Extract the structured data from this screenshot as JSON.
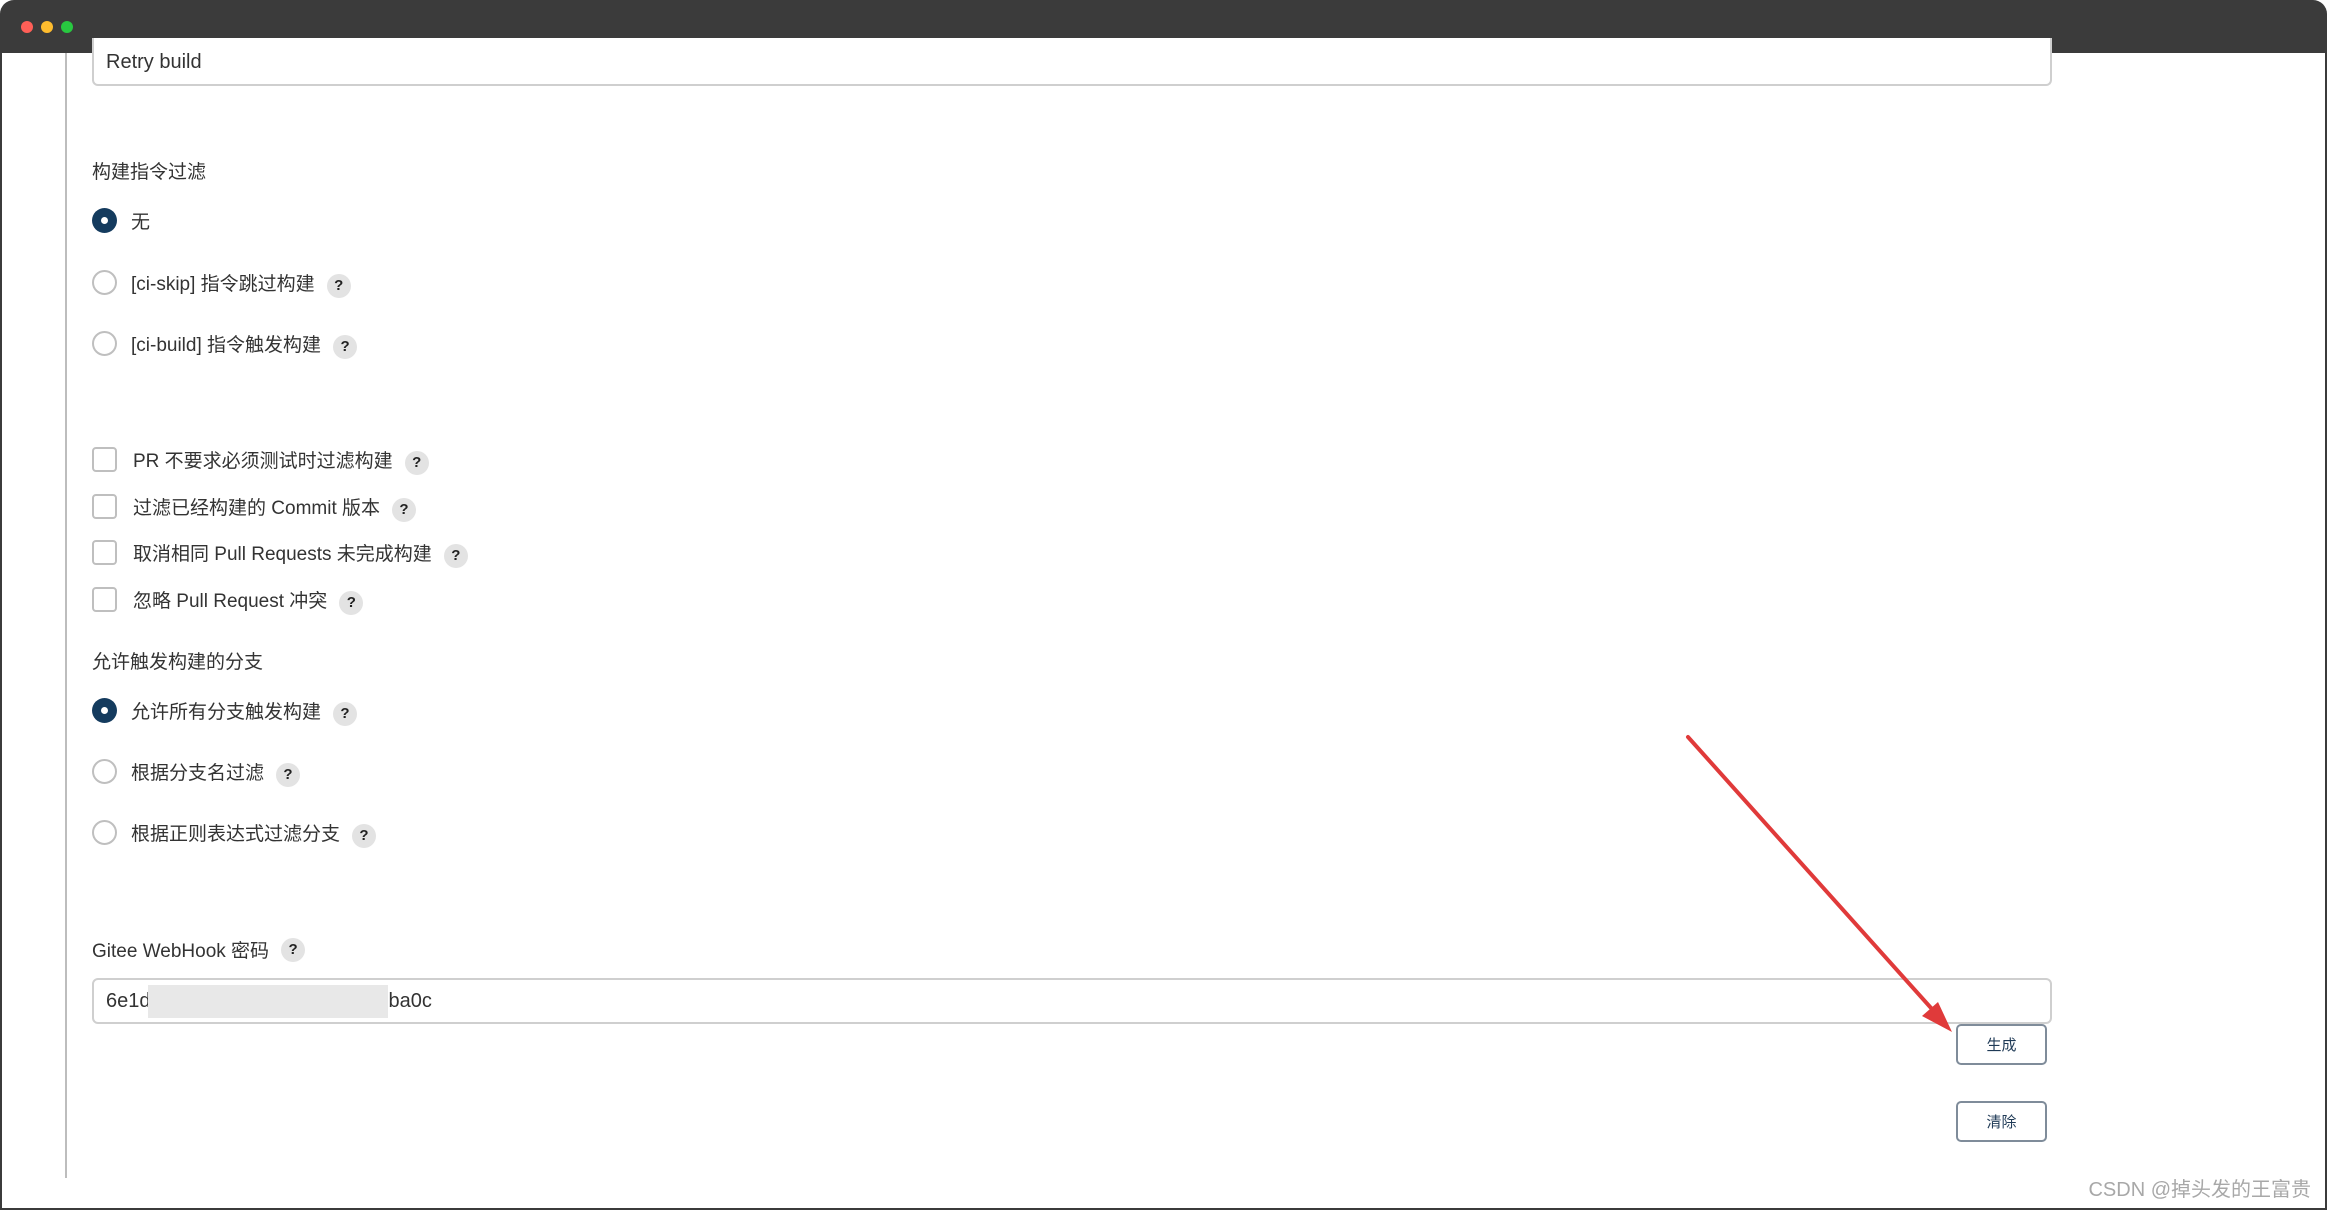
{
  "retry_input": {
    "value": "Retry build"
  },
  "build_filter": {
    "label": "构建指令过滤",
    "options": [
      {
        "label": "无",
        "selected": true
      },
      {
        "label": "[ci-skip] 指令跳过构建",
        "selected": false
      },
      {
        "label": "[ci-build] 指令触发构建",
        "selected": false
      }
    ]
  },
  "checkboxes": [
    {
      "label": "PR 不要求必须测试时过滤构建",
      "checked": false
    },
    {
      "label": "过滤已经构建的 Commit 版本",
      "checked": false
    },
    {
      "label": "取消相同 Pull Requests 未完成构建",
      "checked": false
    },
    {
      "label": "忽略 Pull Request 冲突",
      "checked": false
    }
  ],
  "branch_filter": {
    "label": "允许触发构建的分支",
    "options": [
      {
        "label": "允许所有分支触发构建",
        "selected": true
      },
      {
        "label": "根据分支名过滤",
        "selected": false
      },
      {
        "label": "根据正则表达式过滤分支",
        "selected": false
      }
    ]
  },
  "webhook": {
    "label": "Gitee WebHook 密码",
    "value_start": "6e1d",
    "value_end": "ba0c"
  },
  "buttons": {
    "generate": "生成",
    "clear": "清除"
  },
  "help_glyph": "?",
  "watermark": "CSDN @掉头发的王富贵",
  "colors": {
    "radio_selected": "#143b5e",
    "arrow": "#e03a3a",
    "titlebar": "#3b3b3b"
  }
}
